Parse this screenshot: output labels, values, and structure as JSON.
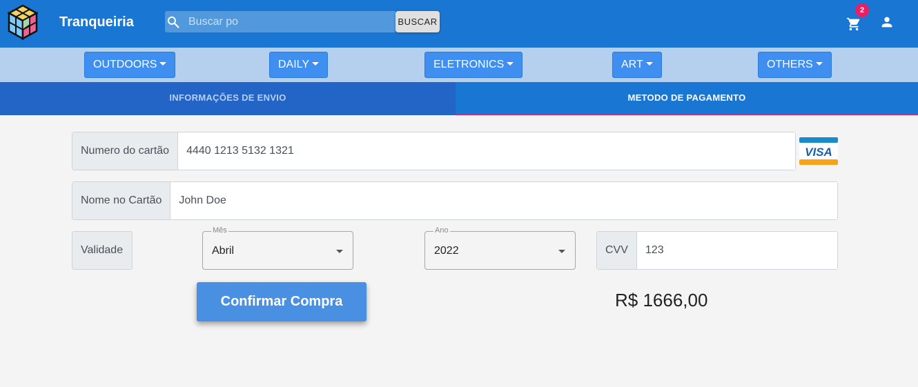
{
  "header": {
    "brand": "Tranqueiria",
    "search_placeholder": "Buscar po",
    "search_button": "BUSCAR",
    "cart_count": "2"
  },
  "categories": [
    {
      "label": "OUTDOORS"
    },
    {
      "label": "DAILY"
    },
    {
      "label": "ELETRONICS"
    },
    {
      "label": "ART"
    },
    {
      "label": "OTHERS"
    }
  ],
  "tabs": [
    {
      "label": "INFORMAÇÕES DE ENVIO",
      "active": false
    },
    {
      "label": "METODO DE PAGAMENTO",
      "active": true
    }
  ],
  "form": {
    "card_number_label": "Numero do cartão",
    "card_number_value": "4440 1213 5132 1321",
    "card_brand": "VISA",
    "card_name_label": "Nome no Cartão",
    "card_name_value": "John Doe",
    "validity_label": "Validade",
    "month_legend": "Mês",
    "month_value": "Abril",
    "year_legend": "Ano",
    "year_value": "2022",
    "cvv_label": "CVV",
    "cvv_value": "123"
  },
  "actions": {
    "confirm_label": "Confirmar Compra"
  },
  "total": "R$ 1666,00",
  "colors": {
    "primary": "#1976d2",
    "category_bar": "#b5d0ef",
    "category_button": "#3f8ff0",
    "tab_indicator": "#e91e63",
    "badge": "#e91e63",
    "confirm_button": "#4a90e2"
  }
}
